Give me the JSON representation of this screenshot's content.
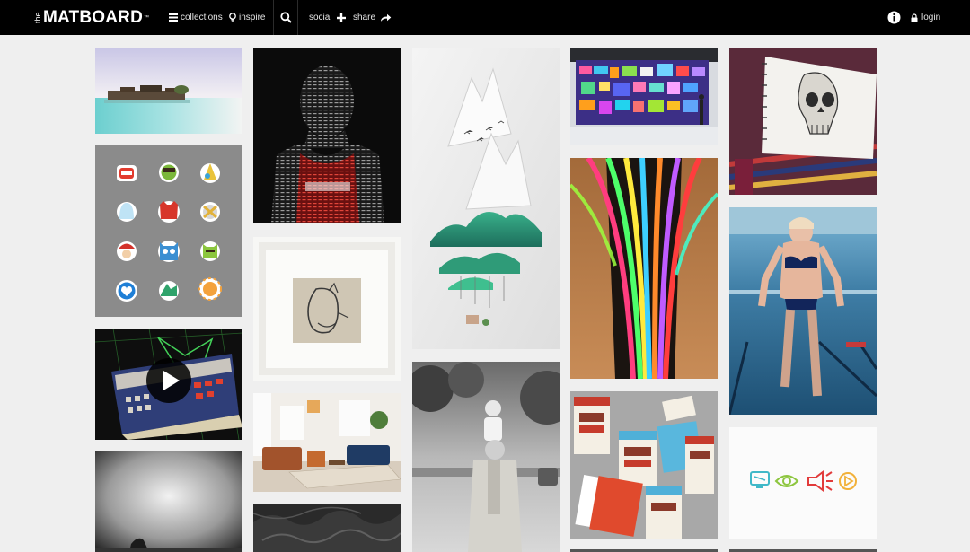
{
  "brand": {
    "prefix": "the",
    "name": "MATBOARD",
    "tm": "™"
  },
  "nav": {
    "collections": "collections",
    "inspire": "inspire",
    "social": "social",
    "share": "share",
    "login": "login"
  },
  "icons": {
    "collections": "list-icon",
    "inspire": "lightbulb-icon",
    "search": "search-icon",
    "social": "plus-icon",
    "share": "share-arrow-icon",
    "info": "info-icon",
    "login": "lock-icon",
    "video": "play-icon"
  },
  "colors": {
    "topbar": "#000000",
    "page_background": "#efefef",
    "nav_text": "#e5e5e5"
  },
  "tiles": {
    "col1": [
      "tropical-resort-photo",
      "emoji-sticker-set",
      "synth-keyboard-video",
      "misty-seascape-photo"
    ],
    "col2": [
      "typographic-basketball-portrait",
      "framed-cat-sketch",
      "living-room-interior",
      "embossed-texture"
    ],
    "col3": [
      "paper-mountain-art",
      "vintage-father-son-photo"
    ],
    "col4": [
      "data-wall-display",
      "neon-zebra-stripes",
      "iced-coffee-packaging"
    ],
    "col5": [
      "skull-sketchbook",
      "underwater-swimmer",
      "icon-set"
    ]
  }
}
